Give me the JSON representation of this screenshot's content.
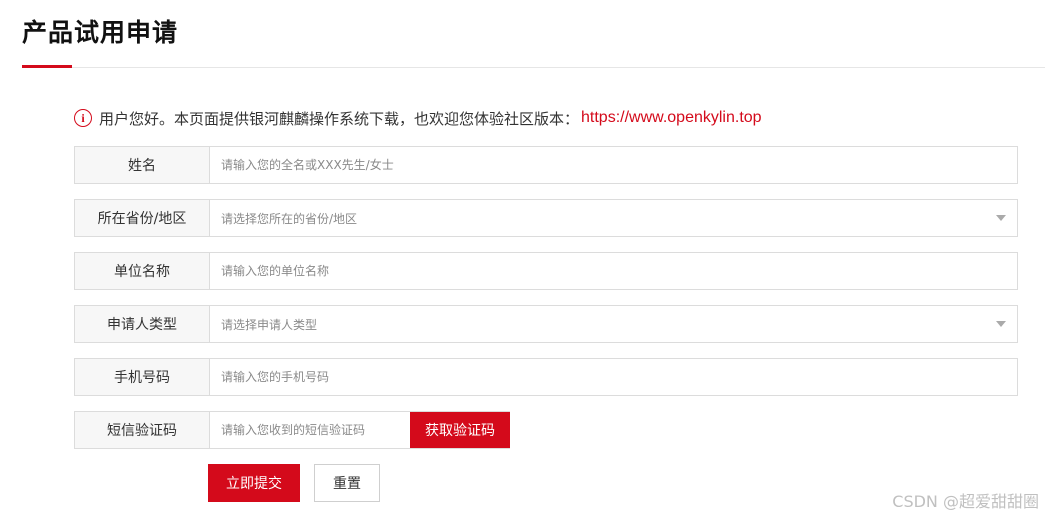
{
  "page": {
    "title": "产品试用申请",
    "accent_color": "#d40a1b"
  },
  "notice": {
    "icon": "info-circle-icon",
    "icon_glyph": "i",
    "text": "用户您好。本页面提供银河麒麟操作系统下载，也欢迎您体验社区版本：",
    "link": "https://www.openkylin.top"
  },
  "form": {
    "name": {
      "label": "姓名",
      "placeholder": "请输入您的全名或XXX先生/女士"
    },
    "region": {
      "label": "所在省份/地区",
      "placeholder": "请选择您所在的省份/地区"
    },
    "company": {
      "label": "单位名称",
      "placeholder": "请输入您的单位名称"
    },
    "applicant_type": {
      "label": "申请人类型",
      "placeholder": "请选择申请人类型"
    },
    "phone": {
      "label": "手机号码",
      "placeholder": "请输入您的手机号码"
    },
    "sms_code": {
      "label": "短信验证码",
      "placeholder": "请输入您收到的短信验证码",
      "button": "获取验证码"
    }
  },
  "actions": {
    "submit": "立即提交",
    "reset": "重置"
  },
  "watermark": "CSDN @超爱甜甜圈"
}
